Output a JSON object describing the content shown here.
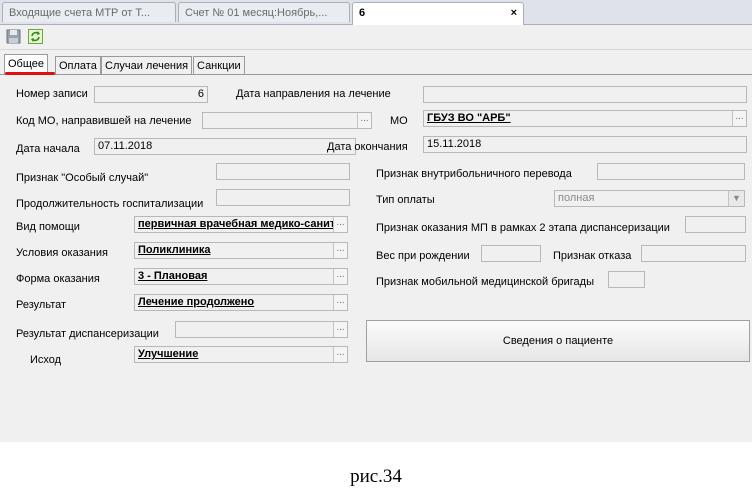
{
  "document_tabs": [
    {
      "label": "Входящие счета МТР от Т..."
    },
    {
      "label": "Счет № 01 месяц:Ноябрь,..."
    },
    {
      "label": "6"
    }
  ],
  "document_tab_close": "×",
  "toolbar": {
    "save_icon": "save-icon",
    "refresh_icon": "refresh-icon"
  },
  "form_tabs": [
    {
      "label": "Общее"
    },
    {
      "label": "Оплата"
    },
    {
      "label": "Случаи лечения"
    },
    {
      "label": "Санкции"
    }
  ],
  "fields": {
    "record_number": {
      "label": "Номер записи",
      "value": "6"
    },
    "referral_date": {
      "label": "Дата направления на лечение",
      "value": ""
    },
    "referring_mo_code": {
      "label": "Код МО, направившей на лечение",
      "value": ""
    },
    "mo": {
      "label": "МО",
      "value": "ГБУЗ ВО \"АРБ\""
    },
    "start_date": {
      "label": "Дата начала",
      "value": "07.11.2018"
    },
    "end_date": {
      "label": "Дата окончания",
      "value": "15.11.2018"
    },
    "special_case": {
      "label": "Признак \"Особый случай\"",
      "value": ""
    },
    "hospitalization_duration": {
      "label": "Продолжительность госпитализации",
      "value": ""
    },
    "care_type": {
      "label": "Вид помощи",
      "value": "первичная врачебная медико-санитарная помощь"
    },
    "care_conditions": {
      "label": "Условия оказания",
      "value": "Поликлиника"
    },
    "care_form": {
      "label": "Форма оказания",
      "value": "3 - Плановая"
    },
    "result": {
      "label": "Результат",
      "value": "Лечение продолжено"
    },
    "dispensary_result": {
      "label": "Результат диспансеризации",
      "value": ""
    },
    "outcome": {
      "label": "Исход",
      "value": "Улучшение"
    },
    "intra_hospital_transfer": {
      "label": "Признак внутрибольничного перевода",
      "value": ""
    },
    "payment_type": {
      "label": "Тип оплаты",
      "value": "полная"
    },
    "stage2_dispensary": {
      "label": "Признак оказания МП в рамках 2 этапа диспансеризации",
      "value": ""
    },
    "birth_weight": {
      "label": "Вес при рождении",
      "value": ""
    },
    "refusal": {
      "label": "Признак отказа",
      "value": ""
    },
    "mobile_brigade": {
      "label": "Признак мобильной медицинской бригады",
      "value": ""
    }
  },
  "patient_button": "Сведения о пациенте",
  "lookup_button": "...",
  "caption": "рис.34",
  "colors": {
    "accent_underline": "#e01010"
  }
}
